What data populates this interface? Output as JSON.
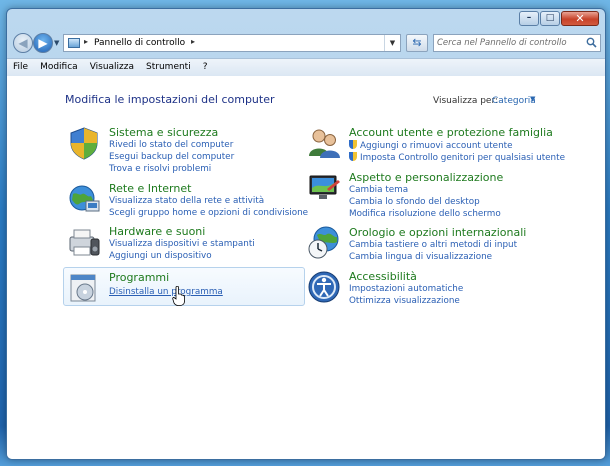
{
  "window": {
    "caption_buttons": [
      "minimize",
      "maximize",
      "close"
    ]
  },
  "address": {
    "breadcrumb": "Pannello di controllo",
    "search_placeholder": "Cerca nel Pannello di controllo"
  },
  "menu": [
    "File",
    "Modifica",
    "Visualizza",
    "Strumenti",
    "?"
  ],
  "content": {
    "heading": "Modifica le impostazioni del computer",
    "view_by_label": "Visualizza per:",
    "view_by_value": "Categoria"
  },
  "categories_left": [
    {
      "title": "Sistema e sicurezza",
      "icon": "system-security-icon",
      "links": [
        "Rivedi lo stato del computer",
        "Esegui backup del computer",
        "Trova e risolvi problemi"
      ]
    },
    {
      "title": "Rete e Internet",
      "icon": "network-internet-icon",
      "links": [
        "Visualizza stato della rete e attività",
        "Scegli gruppo home e opzioni di condivisione"
      ]
    },
    {
      "title": "Hardware e suoni",
      "icon": "hardware-sound-icon",
      "links": [
        "Visualizza dispositivi e stampanti",
        "Aggiungi un dispositivo"
      ]
    },
    {
      "title": "Programmi",
      "icon": "programs-icon",
      "links": [
        "Disinstalla un programma"
      ]
    }
  ],
  "categories_right": [
    {
      "title": "Account utente e protezione famiglia",
      "icon": "user-accounts-icon",
      "links": [
        "Aggiungi o rimuovi account utente",
        "Imposta Controllo genitori per qualsiasi utente"
      ]
    },
    {
      "title": "Aspetto e personalizzazione",
      "icon": "appearance-icon",
      "links": [
        "Cambia tema",
        "Cambia lo sfondo del desktop",
        "Modifica risoluzione dello schermo"
      ]
    },
    {
      "title": "Orologio e opzioni internazionali",
      "icon": "clock-region-icon",
      "links": [
        "Cambia tastiere o altri metodi di input",
        "Cambia lingua di visualizzazione"
      ]
    },
    {
      "title": "Accessibilità",
      "icon": "accessibility-icon",
      "links": [
        "Impostazioni automatiche",
        "Ottimizza visualizzazione"
      ]
    }
  ],
  "colors": {
    "category_title": "#1e7a1e",
    "link": "#2a5fb4",
    "heading": "#1e3287"
  }
}
